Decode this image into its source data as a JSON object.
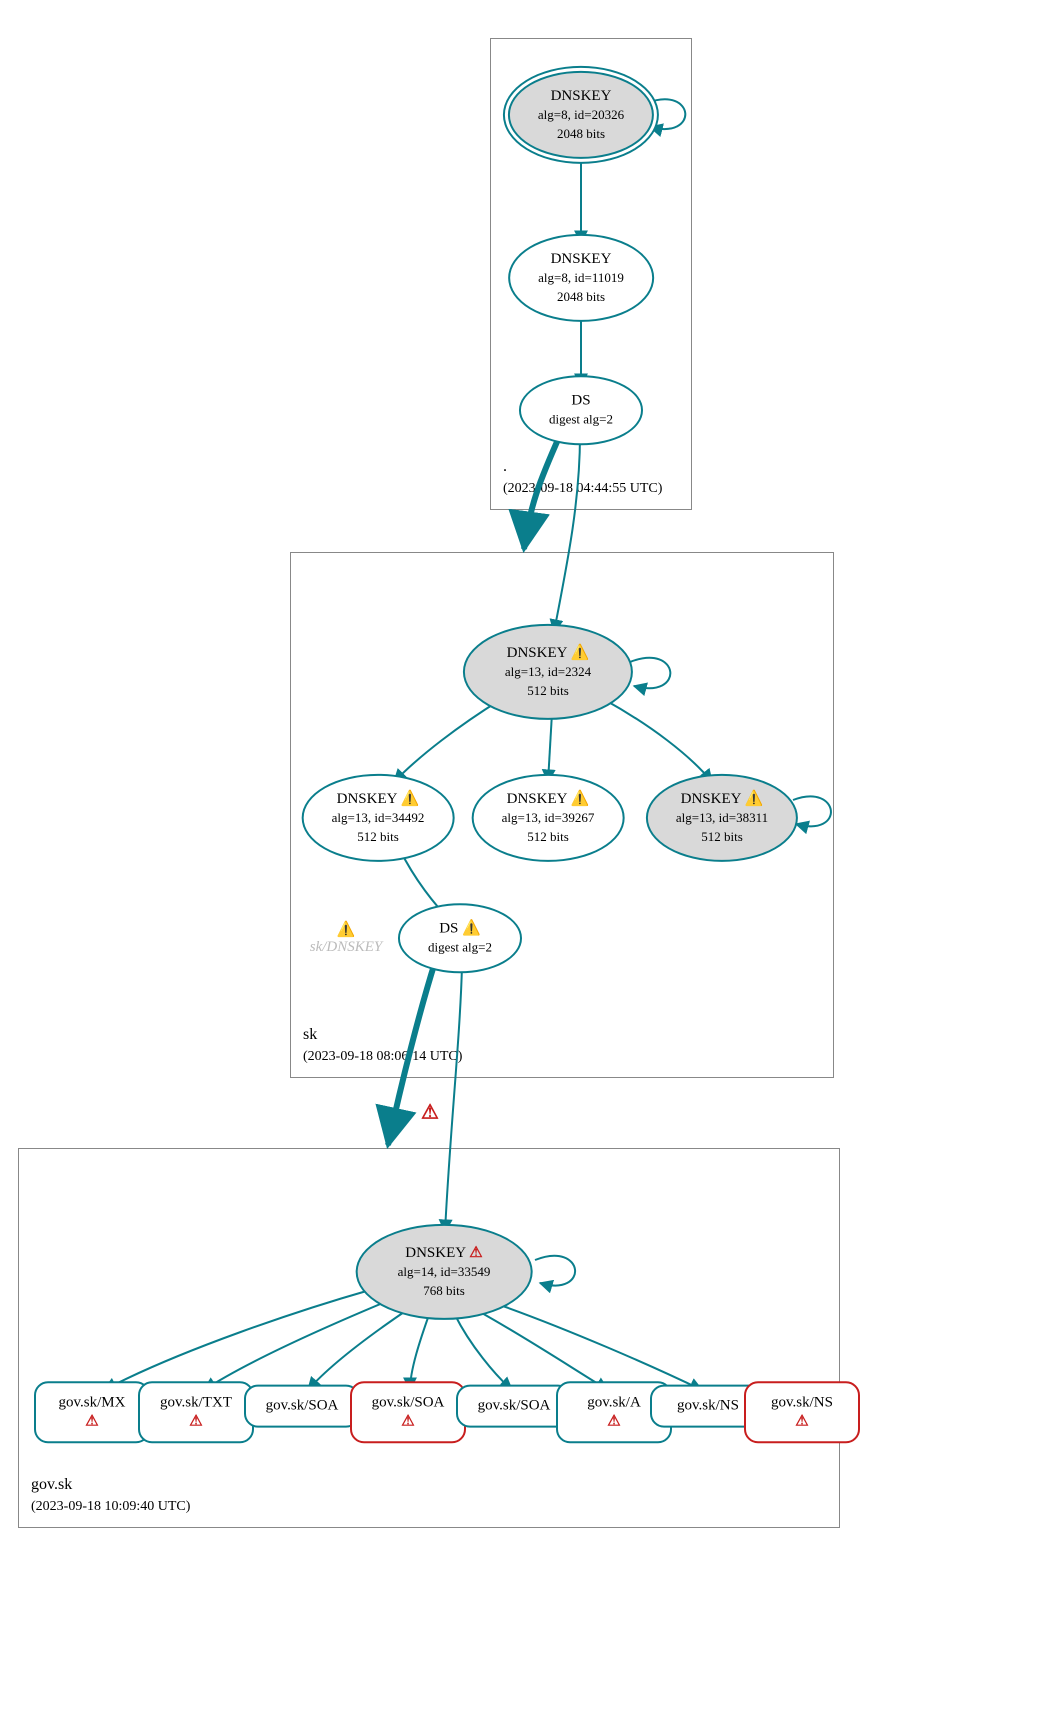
{
  "zones": {
    "root": {
      "label": ".",
      "timestamp": "(2023-09-18 04:44:55 UTC)"
    },
    "sk": {
      "label": "sk",
      "timestamp": "(2023-09-18 08:06:14 UTC)"
    },
    "gov": {
      "label": "gov.sk",
      "timestamp": "(2023-09-18 10:09:40 UTC)"
    }
  },
  "nodes": {
    "root_ksk": {
      "title": "DNSKEY",
      "line2": "alg=8, id=20326",
      "line3": "2048 bits"
    },
    "root_zsk": {
      "title": "DNSKEY",
      "line2": "alg=8, id=11019",
      "line3": "2048 bits"
    },
    "root_ds": {
      "title": "DS",
      "line2": "digest alg=2"
    },
    "sk_ksk": {
      "title": "DNSKEY",
      "warn": true,
      "line2": "alg=13, id=2324",
      "line3": "512 bits"
    },
    "sk_z1": {
      "title": "DNSKEY",
      "warn": true,
      "line2": "alg=13, id=34492",
      "line3": "512 bits"
    },
    "sk_z2": {
      "title": "DNSKEY",
      "warn": true,
      "line2": "alg=13, id=39267",
      "line3": "512 bits"
    },
    "sk_z3": {
      "title": "DNSKEY",
      "warn": true,
      "line2": "alg=13, id=38311",
      "line3": "512 bits"
    },
    "sk_ds": {
      "title": "DS",
      "warn": true,
      "line2": "digest alg=2"
    },
    "sk_faint": {
      "label": "sk/DNSKEY",
      "warn": true
    },
    "gov_key": {
      "title": "DNSKEY",
      "err": true,
      "line2": "alg=14, id=33549",
      "line3": "768 bits"
    },
    "rr_mx": {
      "label": "gov.sk/MX",
      "err": true
    },
    "rr_txt": {
      "label": "gov.sk/TXT",
      "err": true
    },
    "rr_soa1": {
      "label": "gov.sk/SOA"
    },
    "rr_soa2": {
      "label": "gov.sk/SOA",
      "err": true,
      "red": true
    },
    "rr_soa3": {
      "label": "gov.sk/SOA"
    },
    "rr_a": {
      "label": "gov.sk/A",
      "err": true
    },
    "rr_ns1": {
      "label": "gov.sk/NS"
    },
    "rr_ns2": {
      "label": "gov.sk/NS",
      "err": true,
      "red": true
    }
  },
  "icons": {
    "warn": "⚠️",
    "err": "⚠"
  },
  "colors": {
    "stroke": "#0a7e8c",
    "error": "#c81e1e"
  }
}
